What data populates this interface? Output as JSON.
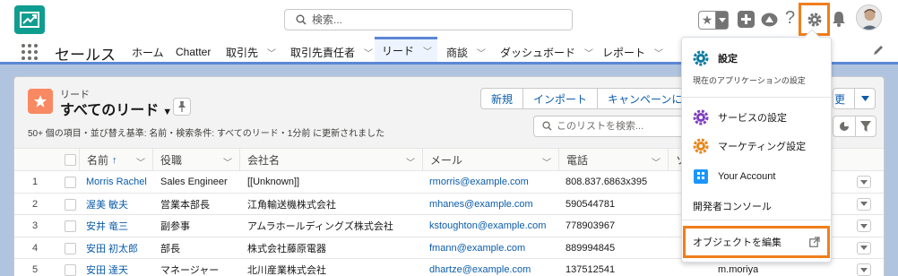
{
  "header": {
    "search_placeholder": "検索...",
    "app_logo": "trend-chart-logo",
    "icons": [
      "favorites-star-icon",
      "add-icon",
      "trailhead-icon",
      "help-icon",
      "setup-gear-icon",
      "notification-bell-icon",
      "user-avatar"
    ]
  },
  "nav": {
    "app_name": "セールス",
    "items": [
      {
        "label": "ホーム",
        "has_menu": false
      },
      {
        "label": "Chatter",
        "has_menu": false
      },
      {
        "label": "取引先",
        "has_menu": true
      },
      {
        "label": "取引先責任者",
        "has_menu": true
      },
      {
        "label": "リード",
        "has_menu": true,
        "active": true
      },
      {
        "label": "商談",
        "has_menu": true
      },
      {
        "label": "ダッシュボード",
        "has_menu": true
      },
      {
        "label": "レポート",
        "has_menu": true
      }
    ]
  },
  "list": {
    "object_label": "リード",
    "title": "すべてのリード",
    "subtitle": "50+ 個の項目・並び替え基準: 名前・検索条件: すべてのリード・1分前 に更新されました",
    "buttons": [
      "新規",
      "インポート",
      "キャンペーンに追加"
    ],
    "partial_button": "更",
    "search_placeholder": "このリストを検索..."
  },
  "table": {
    "columns": [
      "名前",
      "役職",
      "会社名",
      "メール",
      "電話",
      "ソ"
    ],
    "sort_indicator": "↑",
    "rows": [
      {
        "num": "1",
        "name": "Morris Rachel",
        "title": "Sales Engineer",
        "company": "[[Unknown]]",
        "email": "rmorris@example.com",
        "phone": "808.837.6863x395",
        "owner": ""
      },
      {
        "num": "2",
        "name": "渥美 敏夫",
        "title": "営業本部長",
        "company": "江角輸送機株式会社",
        "email": "mhanes@example.com",
        "phone": "590544781",
        "owner": ""
      },
      {
        "num": "3",
        "name": "安井 竜三",
        "title": "副参事",
        "company": "アムラホールディングズ株式会社",
        "email": "kstoughton@example.com",
        "phone": "778903967",
        "owner": ""
      },
      {
        "num": "4",
        "name": "安田 初太郎",
        "title": "部長",
        "company": "株式会社藤原電器",
        "email": "fmann@example.com",
        "phone": "889994845",
        "owner": ""
      },
      {
        "num": "5",
        "name": "安田 達天",
        "title": "マネージャー",
        "company": "北川産業株式会社",
        "email": "dhartze@example.com",
        "phone": "137512541",
        "owner": "m.moriya"
      }
    ]
  },
  "setup_menu": {
    "setup_label": "設定",
    "setup_sub": "現在のアプリケーションの設定",
    "service_setup": "サービスの設定",
    "marketing_setup": "マーケティング設定",
    "your_account": "Your Account",
    "dev_console": "開発者コンソール",
    "edit_object": "オブジェクトを編集"
  },
  "colors": {
    "brand_blue": "#0b5cab",
    "highlight_orange": "#f07e1b",
    "lead_orange": "#f88962",
    "logo_teal": "#0f9d8f"
  }
}
